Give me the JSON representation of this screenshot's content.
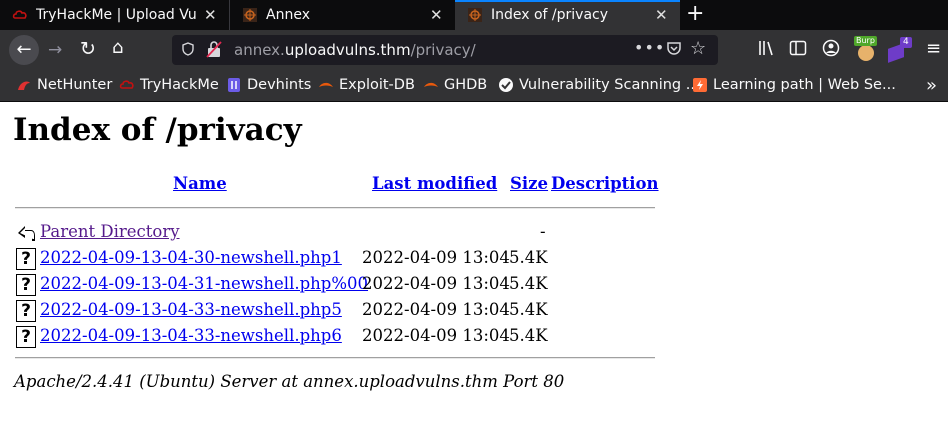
{
  "browser": {
    "tabs": [
      {
        "title": "TryHackMe | Upload Vuln",
        "active": false,
        "close": "✕"
      },
      {
        "title": "Annex",
        "active": false,
        "close": "✕"
      },
      {
        "title": "Index of /privacy",
        "active": true,
        "close": "✕"
      }
    ],
    "new_tab": "+",
    "url": {
      "prefix": "annex.",
      "host": "uploadvulns.thm",
      "path": "/privacy/"
    },
    "extensions": {
      "burp_badge": "Burp",
      "ext_count": "4"
    },
    "bookmarks": [
      {
        "label": "NetHunter",
        "icon": "nethunter-icon"
      },
      {
        "label": "TryHackMe",
        "icon": "tryhackme-icon"
      },
      {
        "label": "Devhints",
        "icon": "devhints-icon"
      },
      {
        "label": "Exploit-DB",
        "icon": "exploitdb-icon"
      },
      {
        "label": "GHDB",
        "icon": "ghdb-icon"
      },
      {
        "label": "Vulnerability Scanning ...",
        "icon": "vuln-scan-icon"
      },
      {
        "label": "Learning path | Web Se...",
        "icon": "learning-path-icon"
      }
    ]
  },
  "page": {
    "heading": "Index of /privacy",
    "columns": {
      "name": "Name",
      "last_modified": "Last modified",
      "size": "Size",
      "description": "Description"
    },
    "parent": {
      "name": "Parent Directory",
      "size": "-"
    },
    "files": [
      {
        "name": "2022-04-09-13-04-30-newshell.php1",
        "modified": "2022-04-09 13:04",
        "size": "5.4K"
      },
      {
        "name": "2022-04-09-13-04-31-newshell.php%00",
        "modified": "2022-04-09 13:04",
        "size": "5.4K"
      },
      {
        "name": "2022-04-09-13-04-33-newshell.php5",
        "modified": "2022-04-09 13:04",
        "size": "5.4K"
      },
      {
        "name": "2022-04-09-13-04-33-newshell.php6",
        "modified": "2022-04-09 13:04",
        "size": "5.4K"
      }
    ],
    "footer": "Apache/2.4.41 (Ubuntu) Server at annex.uploadvulns.thm Port 80"
  },
  "colors": {
    "link": "#0000ee",
    "visited": "#551a8b",
    "chrome_dark": "#0c0c0d",
    "toolbar": "#323234",
    "accent": "#0a84ff"
  }
}
